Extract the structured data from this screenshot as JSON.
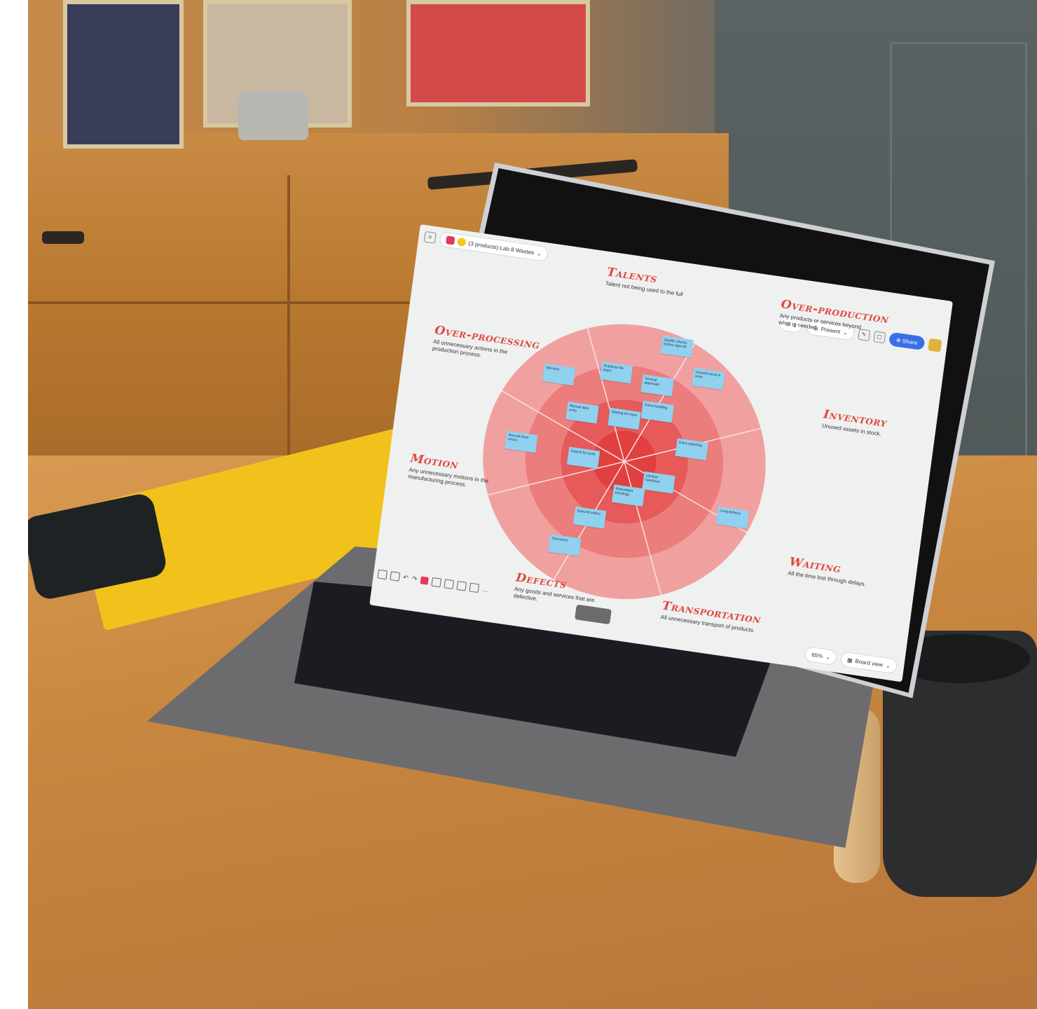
{
  "app": {
    "board_title": "(3 products) Lab 8 Wastes",
    "present_label": "Present",
    "share_label": "Share",
    "participants_count": "2",
    "zoom_level": "65%",
    "board_view_label": "Board view",
    "accent_color": "#e8345e",
    "share_color": "#3b6fe8"
  },
  "wheel": {
    "outer_color": "#f1a0a0",
    "mid_color": "#ec7d7d",
    "inner_color": "#e65a5a",
    "core_color": "#e0403f",
    "segments": [
      {
        "title": "Talents",
        "description": "Talent not being used to the full"
      },
      {
        "title": "Over-production",
        "description": "Any products or services beyond what is needed."
      },
      {
        "title": "Inventory",
        "description": "Unused assets in stock."
      },
      {
        "title": "Waiting",
        "description": "All the time lost through delays."
      },
      {
        "title": "Transportation",
        "description": "All unnecessary transport of products."
      },
      {
        "title": "Defects",
        "description": "Any goods and services that are defective."
      },
      {
        "title": "Motion",
        "description": "Any unnecessary motions in the manufacturing process."
      },
      {
        "title": "Over-processing",
        "description": "All unnecessary actions in the production process."
      }
    ]
  },
  "stickies": [
    "Quality checks before sign-off",
    "Unused stock in store",
    "Several approvals",
    "Extra handling",
    "Duplicate file steps",
    "Idle time",
    "Manual data entry",
    "Waiting for input",
    "Extra reporting",
    "Rework from errors",
    "Search for tools",
    "Unclear handover",
    "Redundant meetings",
    "Long delivery",
    "Queued orders",
    "Overstock"
  ]
}
